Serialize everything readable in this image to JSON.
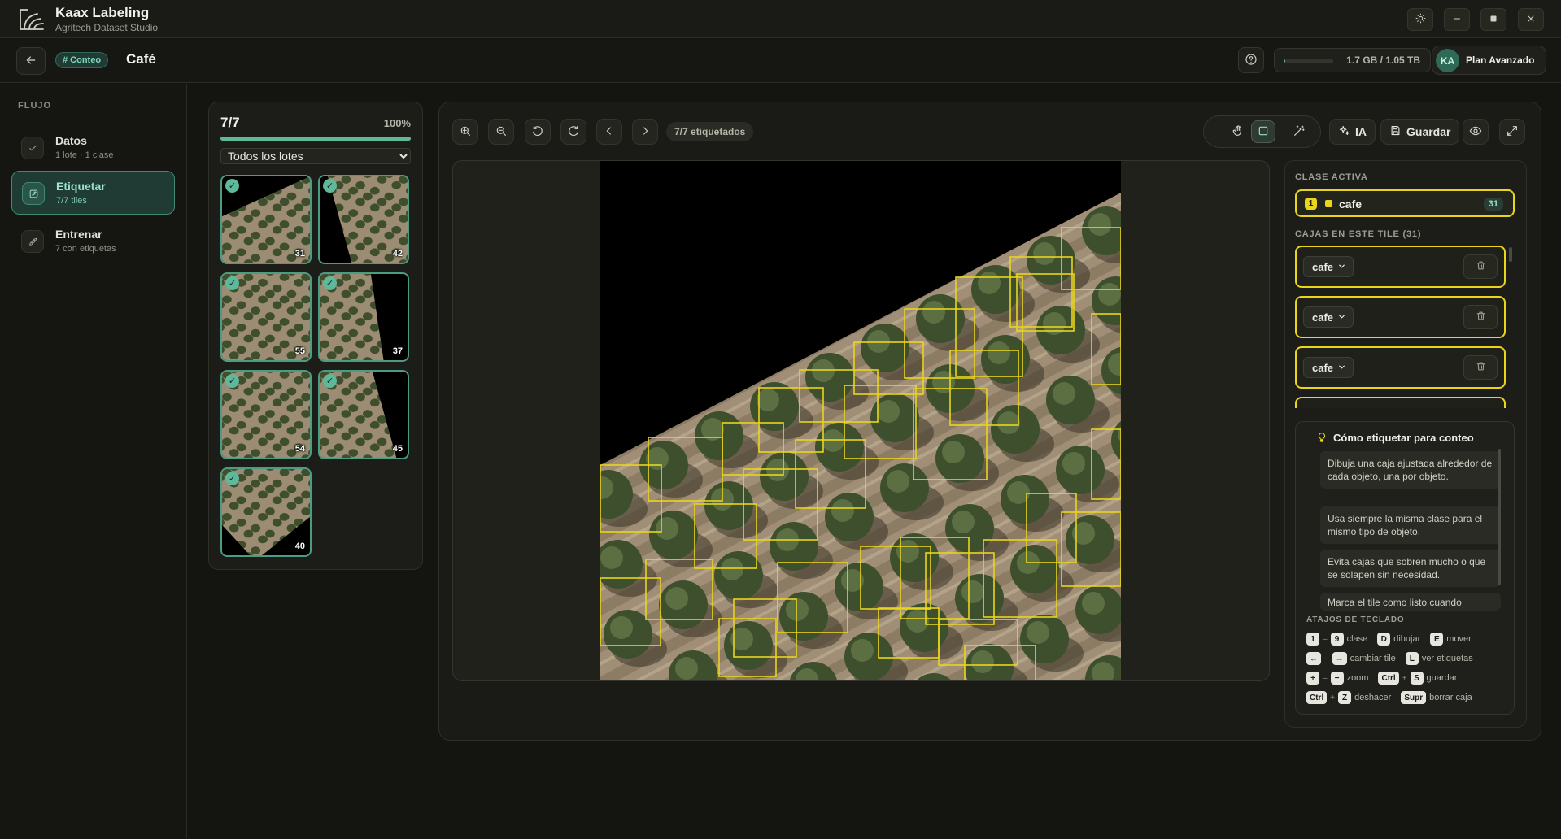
{
  "app": {
    "title": "Kaax Labeling",
    "subtitle": "Agritech Dataset Studio"
  },
  "header": {
    "mode_badge": "# Conteo",
    "project_title": "Café",
    "storage_text": "1.7 GB / 1.05 TB",
    "storage_fraction": 0.0016,
    "avatar_initials": "KA",
    "plan_label": "Plan Avanzado"
  },
  "sidebar": {
    "flow_label": "FLUJO",
    "steps": [
      {
        "title": "Datos",
        "subtitle": "1 lote · 1 clase",
        "icon": "check-icon",
        "active": false
      },
      {
        "title": "Etiquetar",
        "subtitle": "7/7 tiles",
        "icon": "edit-icon",
        "active": true
      },
      {
        "title": "Entrenar",
        "subtitle": "7 con etiquetas",
        "icon": "rocket-icon",
        "active": false
      }
    ]
  },
  "tiles": {
    "count_label": "7/7",
    "percent_label": "100%",
    "progress_fraction": 1.0,
    "batch_selected": "Todos los lotes",
    "items": [
      {
        "count": "31",
        "done": true
      },
      {
        "count": "42",
        "done": true
      },
      {
        "count": "55",
        "done": true
      },
      {
        "count": "37",
        "done": true
      },
      {
        "count": "54",
        "done": true
      },
      {
        "count": "45",
        "done": true
      },
      {
        "count": "40",
        "done": true
      }
    ]
  },
  "toolbar": {
    "labeled_pill": "7/7 etiquetados",
    "ai_label": "IA",
    "save_label": "Guardar"
  },
  "right_panel": {
    "active_class_label": "CLASE ACTIVA",
    "active_class": {
      "number": "1",
      "name": "cafe",
      "count": "31",
      "color": "#e8d51c"
    },
    "boxes_label": "CAJAS EN ESTE TILE (31)",
    "boxes": [
      {
        "class": "cafe"
      },
      {
        "class": "cafe"
      },
      {
        "class": "cafe"
      }
    ],
    "tips_title": "Cómo etiquetar para conteo",
    "tips": [
      "Dibuja una caja ajustada alrededor de cada objeto, una por objeto.",
      "Usa siempre la misma clase para el mismo tipo de objeto.",
      "Evita cajas que sobren mucho o que se solapen sin necesidad.",
      "Marca el tile como listo cuando"
    ],
    "shortcuts_label": "ATAJOS DE TECLADO",
    "shortcuts": {
      "k1a": "1",
      "k1sep": "–",
      "k1b": "9",
      "d1": "clase",
      "k2": "D",
      "d2": "dibujar",
      "k3": "E",
      "d3": "mover",
      "k4a": "←",
      "k4sep": "–",
      "k4b": "→",
      "d4": "cambiar tile",
      "k5": "L",
      "d5": "ver etiquetas",
      "k6a": "+",
      "k6sep": "–",
      "k6b": "−",
      "d6": "zoom",
      "k7a": "Ctrl",
      "k7sep": "+",
      "k7b": "S",
      "d7": "guardar",
      "k8a": "Ctrl",
      "k8sep": "+",
      "k8b": "Z",
      "d8": "deshacer",
      "k9": "Supr",
      "d9": "borrar caja"
    }
  }
}
